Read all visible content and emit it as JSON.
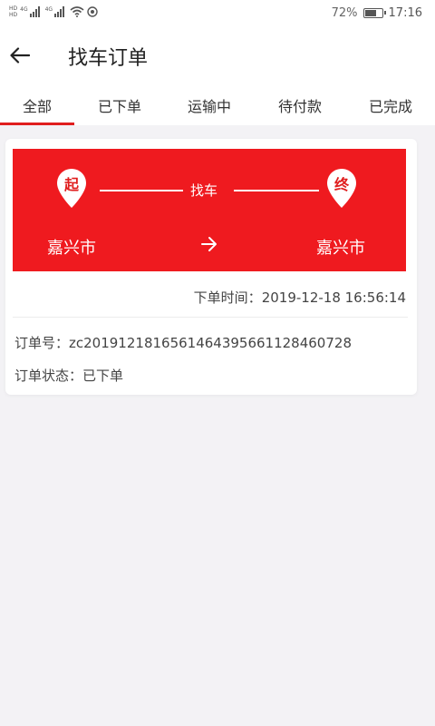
{
  "status_bar": {
    "badge_top": "HD",
    "badge_bottom": "HD",
    "signal_tag_1": "4G",
    "signal_tag_2": "4G",
    "battery_percent": 72,
    "battery_text": "72%",
    "time": "17:16"
  },
  "header": {
    "title": "找车订单"
  },
  "tabs": [
    {
      "label": "全部",
      "active": true
    },
    {
      "label": "已下单",
      "active": false
    },
    {
      "label": "运输中",
      "active": false
    },
    {
      "label": "待付款",
      "active": false
    },
    {
      "label": "已完成",
      "active": false
    }
  ],
  "order": {
    "start_pin": "起",
    "end_pin": "终",
    "route_label": "找车",
    "start_city": "嘉兴市",
    "end_city": "嘉兴市",
    "time_label": "下单时间：",
    "time_value": "2019-12-18 16:56:14",
    "id_label": "订单号：",
    "id_value": "zc20191218165614643956611284607​28",
    "status_label": "订单状态：",
    "status_value": "已下单"
  },
  "colors": {
    "accent": "#ef1a1f",
    "background": "#f3f2f5"
  },
  "icons": {
    "back": "arrow-left-icon",
    "route_arrow": "arrow-right-icon",
    "wifi": "wifi-icon",
    "battery": "battery-icon"
  }
}
